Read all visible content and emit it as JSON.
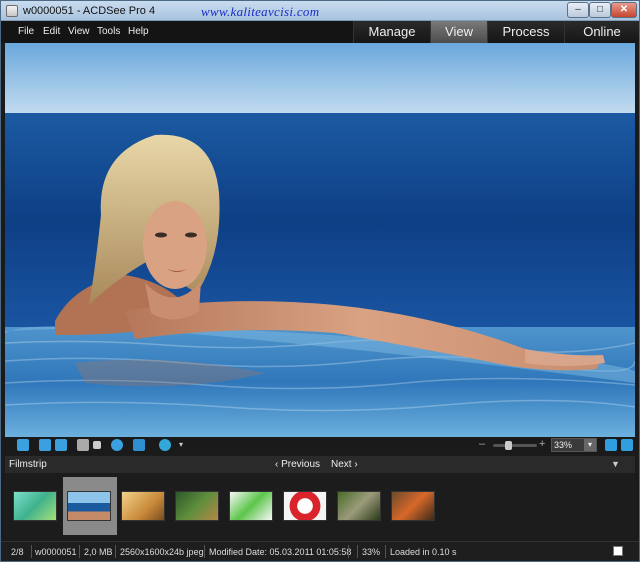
{
  "window": {
    "title": "w0000051 - ACDSee Pro 4",
    "watermark": "www.kaliteavcisi.com",
    "minimize_glyph": "–",
    "maximize_glyph": "□",
    "close_glyph": "✕"
  },
  "menu": [
    "File",
    "Edit",
    "View",
    "Tools",
    "Help"
  ],
  "modes": {
    "manage": "Manage",
    "view": "View",
    "process": "Process",
    "online": "Online",
    "active": "View"
  },
  "toolbar": {
    "zoom_value": "33%",
    "zoom_level": 0.33,
    "zoom_minus": "–",
    "zoom_plus": "+",
    "zoom_drop": "▾"
  },
  "filmstrip": {
    "title": "Filmstrip",
    "prev": "‹ Previous",
    "next": "Next ›",
    "collapse": "▼",
    "thumbnails": [
      {
        "subject": "green-fields",
        "selected": false
      },
      {
        "subject": "woman-in-pool",
        "selected": true
      },
      {
        "subject": "golden-desert",
        "selected": false
      },
      {
        "subject": "forest-frame",
        "selected": false
      },
      {
        "subject": "green-chameleon",
        "selected": false
      },
      {
        "subject": "red-alarm-clock",
        "selected": false
      },
      {
        "subject": "bamboo-panda",
        "selected": false
      },
      {
        "subject": "red-fox",
        "selected": false
      }
    ]
  },
  "status": {
    "position": "2/8",
    "filename": "w0000051",
    "filesize": "2,0 MB",
    "format": "2560x1600x24b jpeg",
    "modified": "Modified Date: 05.03.2011 01:05:58",
    "zoom": "33%",
    "load_time": "Loaded in 0.10 s"
  },
  "colors": {
    "accent_blue": "#2f9fe0",
    "sea": "#0f3f82",
    "sky": "#9cc6e8"
  }
}
